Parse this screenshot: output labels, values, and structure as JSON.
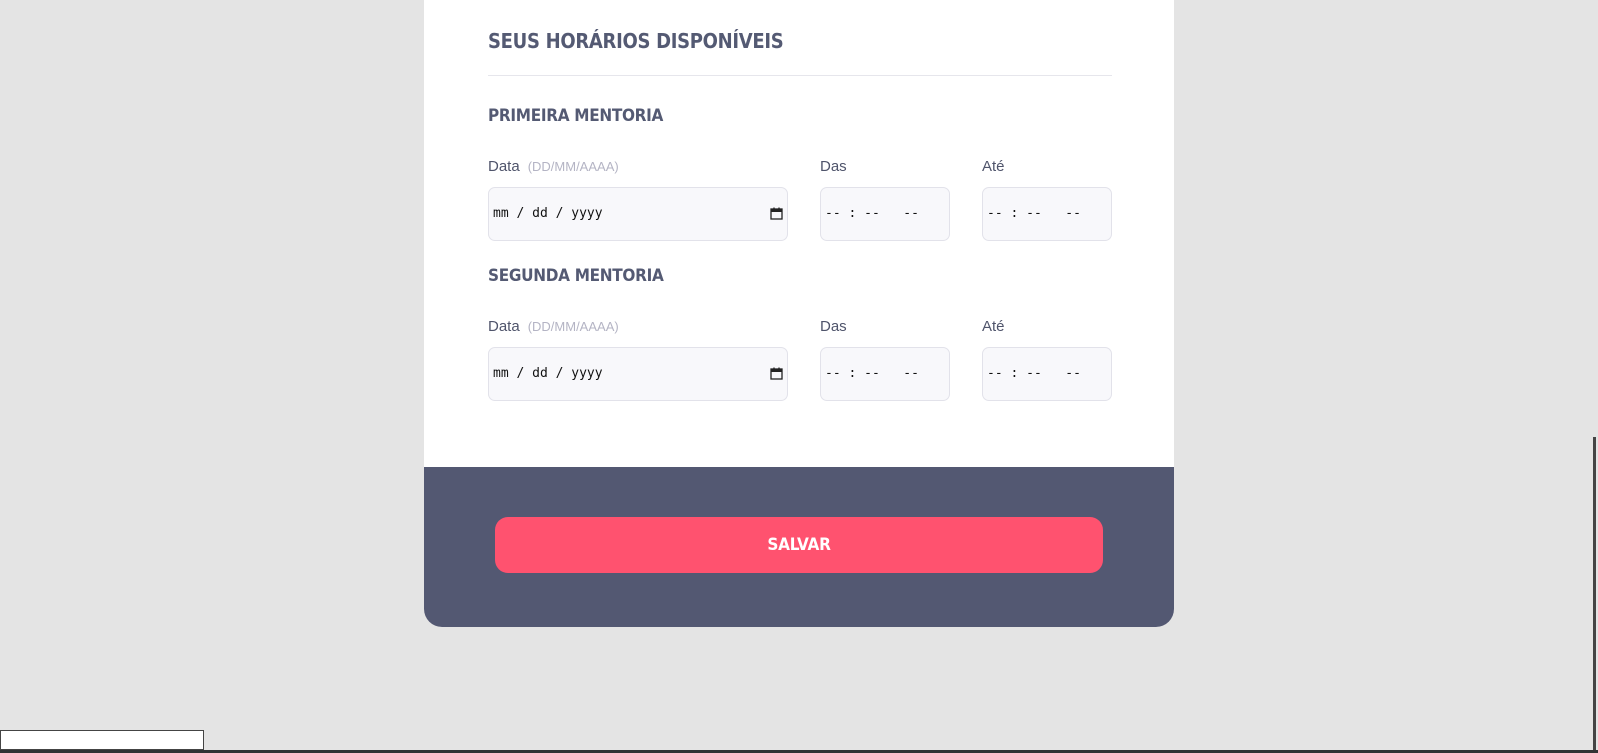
{
  "section": {
    "title": "Seus horários disponíveis"
  },
  "mentorias": [
    {
      "title": "Primeira mentoria",
      "date_label": "Data",
      "date_hint": "(DD/MM/AAAA)",
      "date_value": "mm / dd / yyyy",
      "from_label": "Das",
      "from_value": "-- : --   --",
      "to_label": "Até",
      "to_value": "-- : --   --"
    },
    {
      "title": "Segunda mentoria",
      "date_label": "Data",
      "date_hint": "(DD/MM/AAAA)",
      "date_value": "mm / dd / yyyy",
      "from_label": "Das",
      "from_value": "-- : --   --",
      "to_label": "Até",
      "to_value": "-- : --   --"
    }
  ],
  "footer": {
    "save_label": "Salvar"
  },
  "icons": {
    "date_picker": "calendar-icon"
  },
  "colors": {
    "page_bg": "#e4e4e4",
    "card_bg": "#ffffff",
    "footer_bg": "#535872",
    "accent": "#ff526f",
    "heading": "#545a73"
  }
}
